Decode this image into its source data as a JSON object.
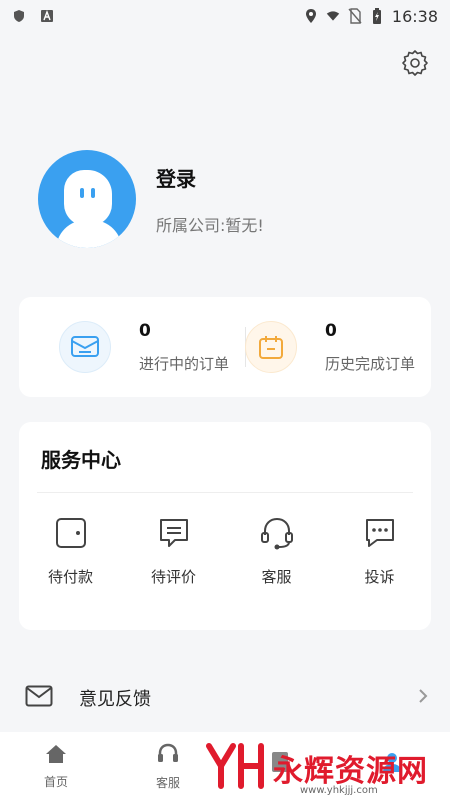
{
  "status_bar": {
    "time": "16:38"
  },
  "profile": {
    "login_label": "登录",
    "company_label": "所属公司:暂无!"
  },
  "orders": [
    {
      "count": "0",
      "label": "进行中的订单",
      "icon": "envelope-check-icon",
      "color": "#3aa0f0"
    },
    {
      "count": "0",
      "label": "历史完成订单",
      "icon": "calendar-icon",
      "color": "#f2a93b"
    }
  ],
  "services": {
    "title": "服务中心",
    "items": [
      {
        "label": "待付款",
        "icon": "wallet-icon"
      },
      {
        "label": "待评价",
        "icon": "comment-icon"
      },
      {
        "label": "客服",
        "icon": "headset-icon"
      },
      {
        "label": "投诉",
        "icon": "chat-dots-icon"
      }
    ]
  },
  "feedback": {
    "label": "意见反馈"
  },
  "tabbar": {
    "items": [
      {
        "label": "首页"
      },
      {
        "label": "客服"
      },
      {
        "label": ""
      },
      {
        "label": ""
      }
    ]
  },
  "watermark": {
    "text": "永辉资源网",
    "url": "www.yhkjjj.com"
  }
}
